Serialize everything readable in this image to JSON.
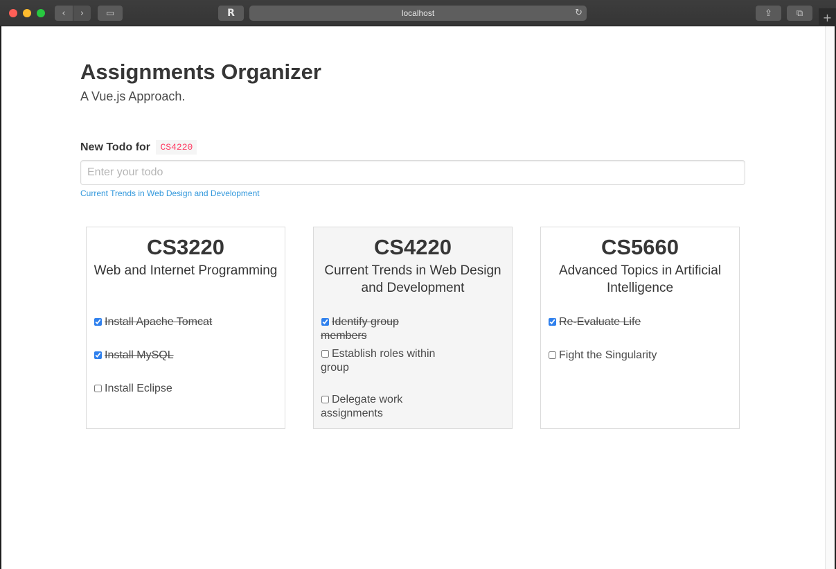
{
  "browser": {
    "url": "localhost",
    "reader_icon": "R",
    "back_icon": "‹",
    "forward_icon": "›",
    "sidebar_icon": "▭",
    "reload_icon": "↻",
    "share_icon": "⇪",
    "tabs_icon": "⧉",
    "newtab_icon": "+"
  },
  "header": {
    "title": "Assignments Organizer",
    "subtitle": "A Vue.js Approach."
  },
  "form": {
    "label": "New Todo for",
    "selected_course": "CS4220",
    "placeholder": "Enter your todo",
    "value": "",
    "help_text": "Current Trends in Web Design and Development"
  },
  "courses": [
    {
      "code": "CS3220",
      "name": "Web and Internet Programming",
      "selected": false,
      "todos": [
        {
          "text": "Install Apache Tomcat",
          "done": true
        },
        {
          "text": "Install MySQL",
          "done": true
        },
        {
          "text": "Install Eclipse",
          "done": false
        }
      ]
    },
    {
      "code": "CS4220",
      "name": "Current Trends in Web Design and Development",
      "selected": true,
      "todos": [
        {
          "text": "Identify group members",
          "done": true
        },
        {
          "text": "Establish roles within group",
          "done": false
        },
        {
          "text": "Delegate work assignments",
          "done": false
        }
      ]
    },
    {
      "code": "CS5660",
      "name": "Advanced Topics in Artificial Intelligence",
      "selected": false,
      "todos": [
        {
          "text": "Re-Evaluate Life",
          "done": true
        },
        {
          "text": "Fight the Singularity",
          "done": false
        }
      ]
    }
  ]
}
